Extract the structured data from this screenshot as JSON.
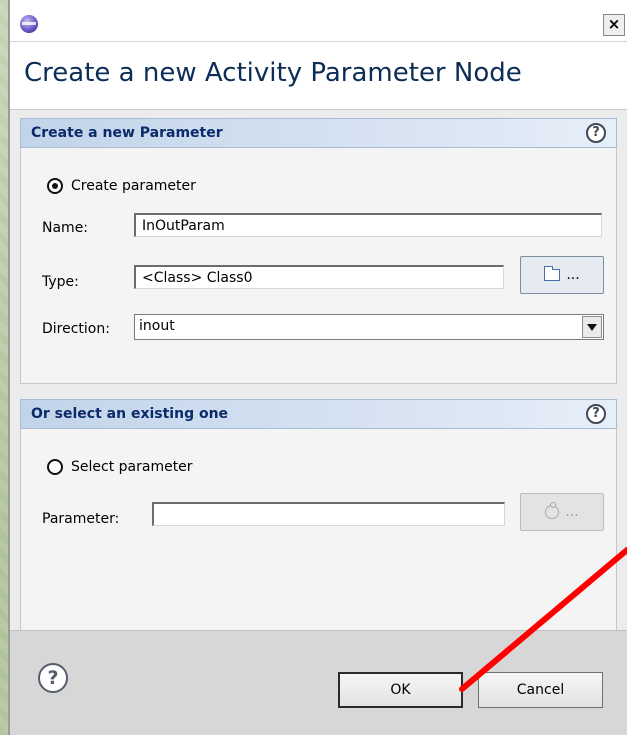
{
  "dialog": {
    "title": "Create a new Activity Parameter Node",
    "close_label": "×"
  },
  "section_new": {
    "header": "Create a new Parameter",
    "radio_label": "Create parameter",
    "name_label": "Name:",
    "name_value": "InOutParam",
    "type_label": "Type:",
    "type_value": "<Class> Class0",
    "browse_label": "...",
    "direction_label": "Direction:",
    "direction_value": "inout"
  },
  "section_existing": {
    "header": "Or select an existing one",
    "radio_label": "Select parameter",
    "parameter_label": "Parameter:",
    "parameter_value": "",
    "browse_label": "..."
  },
  "footer": {
    "help": "?",
    "ok_label": "OK",
    "cancel_label": "Cancel"
  },
  "help_glyph": "?",
  "annotation_color": "#ff0000"
}
